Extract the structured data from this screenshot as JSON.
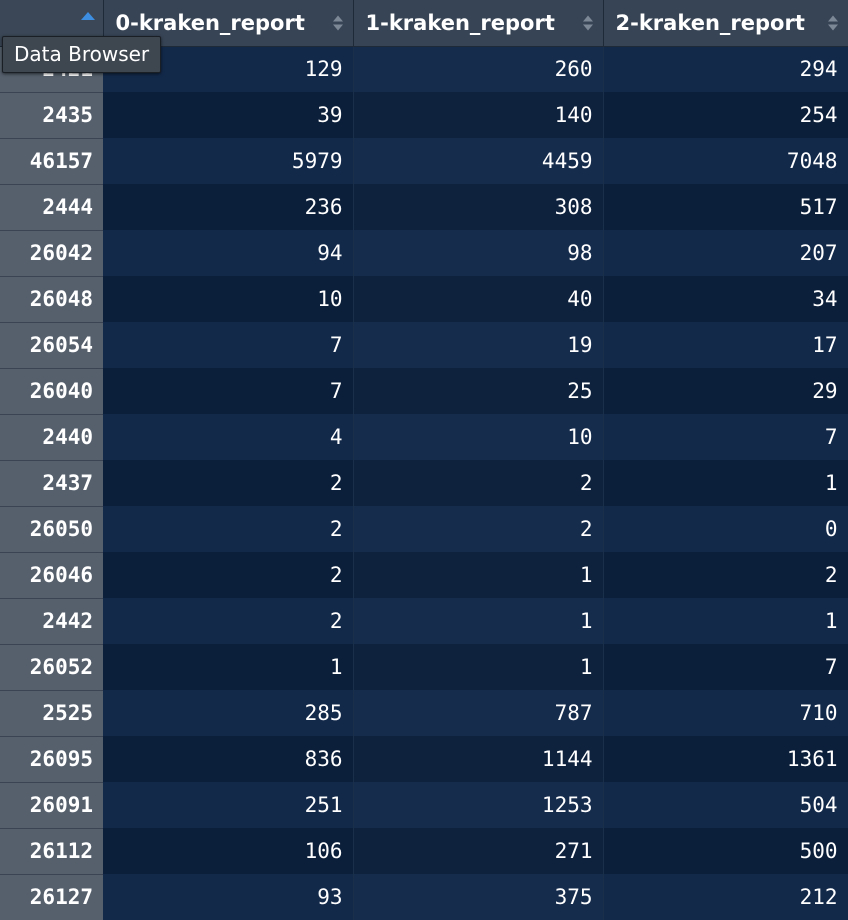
{
  "table": {
    "columns": [
      "0-kraken_report",
      "1-kraken_report",
      "2-kraken_report"
    ],
    "sort_column": "row-names",
    "sort_direction": "ascending",
    "rows": [
      {
        "name": "2421",
        "values": [
          "129",
          "260",
          "294"
        ]
      },
      {
        "name": "2435",
        "values": [
          "39",
          "140",
          "254"
        ]
      },
      {
        "name": "46157",
        "values": [
          "5979",
          "4459",
          "7048"
        ]
      },
      {
        "name": "2444",
        "values": [
          "236",
          "308",
          "517"
        ]
      },
      {
        "name": "26042",
        "values": [
          "94",
          "98",
          "207"
        ]
      },
      {
        "name": "26048",
        "values": [
          "10",
          "40",
          "34"
        ]
      },
      {
        "name": "26054",
        "values": [
          "7",
          "19",
          "17"
        ]
      },
      {
        "name": "26040",
        "values": [
          "7",
          "25",
          "29"
        ]
      },
      {
        "name": "2440",
        "values": [
          "4",
          "10",
          "7"
        ]
      },
      {
        "name": "2437",
        "values": [
          "2",
          "2",
          "1"
        ]
      },
      {
        "name": "26050",
        "values": [
          "2",
          "2",
          "0"
        ]
      },
      {
        "name": "26046",
        "values": [
          "2",
          "1",
          "2"
        ]
      },
      {
        "name": "2442",
        "values": [
          "2",
          "1",
          "1"
        ]
      },
      {
        "name": "26052",
        "values": [
          "1",
          "1",
          "7"
        ]
      },
      {
        "name": "2525",
        "values": [
          "285",
          "787",
          "710"
        ]
      },
      {
        "name": "26095",
        "values": [
          "836",
          "1144",
          "1361"
        ]
      },
      {
        "name": "26091",
        "values": [
          "251",
          "1253",
          "504"
        ]
      },
      {
        "name": "26112",
        "values": [
          "106",
          "271",
          "500"
        ]
      },
      {
        "name": "26127",
        "values": [
          "93",
          "375",
          "212"
        ]
      }
    ]
  },
  "tooltip": {
    "text": "Data Browser"
  },
  "icons": {
    "sort_asc": "sort-ascending-icon",
    "sort_both": "sort-both-icon"
  },
  "colors": {
    "header_bg": "#374455",
    "rowname_bg": "#56606d",
    "row_odd": "#13294a",
    "row_even": "#0c1f3a",
    "sort_active": "#3d8de0"
  }
}
